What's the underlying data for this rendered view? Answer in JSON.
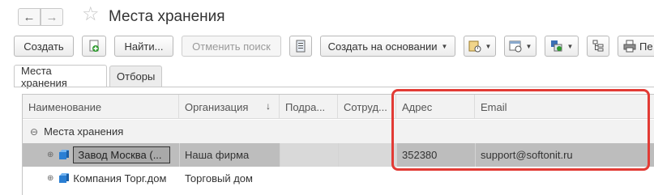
{
  "window": {
    "title": "Места хранения",
    "back_icon": "arrow-left-icon",
    "forward_icon": "arrow-right-icon",
    "favorite_icon": "star-icon"
  },
  "toolbar": {
    "create_label": "Создать",
    "find_label": "Найти...",
    "cancel_search_label": "Отменить поиск",
    "create_based_label": "Создать на основании",
    "print_label": "Пе"
  },
  "tabs": [
    {
      "label": "Места хранения",
      "active": true
    },
    {
      "label": "Отборы",
      "active": false
    }
  ],
  "table": {
    "columns": [
      "Наименование",
      "Организация",
      "Подра...",
      "Сотруд...",
      "Адрес",
      "Email"
    ],
    "sort_indicator": "↓",
    "group_row": {
      "toggle": "⊖",
      "label": "Места хранения"
    },
    "rows": [
      {
        "toggle": "⊕",
        "name": "Завод Москва (...",
        "organization": "Наша фирма",
        "department": "",
        "employee": "",
        "address": "352380",
        "email": "support@softonit.ru",
        "selected": true
      },
      {
        "toggle": "⊕",
        "name": "Компания Торг.дом",
        "organization": "Торговый дом",
        "department": "",
        "employee": "",
        "address": "",
        "email": "",
        "selected": false
      }
    ]
  },
  "highlight_color": "#e23b35"
}
